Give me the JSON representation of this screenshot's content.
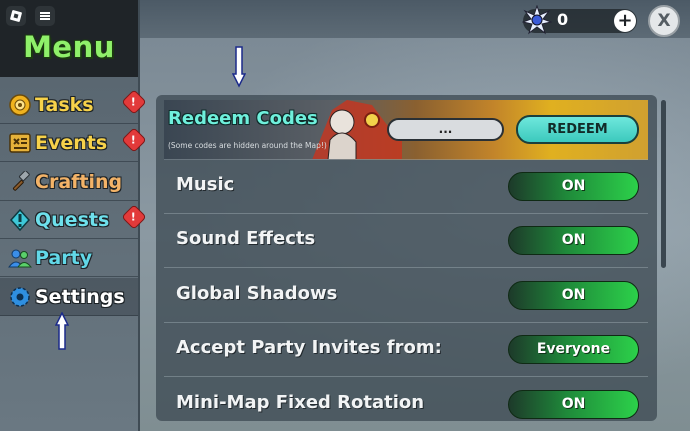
{
  "sidebar": {
    "title": "Menu",
    "items": [
      {
        "label": "Tasks",
        "color": "#f7d24a",
        "icon": "tasks-coin-icon",
        "alert": true
      },
      {
        "label": "Events",
        "color": "#f7d24a",
        "icon": "events-scroll-icon",
        "alert": true
      },
      {
        "label": "Crafting",
        "color": "#f3b368",
        "icon": "hammer-icon",
        "alert": false
      },
      {
        "label": "Quests",
        "color": "#6ee0ec",
        "icon": "quest-marker-icon",
        "alert": true
      },
      {
        "label": "Party",
        "color": "#62d8e8",
        "icon": "party-people-icon",
        "alert": false
      },
      {
        "label": "Settings",
        "color": "#ffffff",
        "icon": "gear-icon",
        "alert": false
      }
    ],
    "alert_glyph": "!"
  },
  "topbar": {
    "currency_icon": "spiky-orb-icon",
    "currency_value": "0",
    "plus_label": "+",
    "close_label": "X"
  },
  "settings": {
    "redeem": {
      "title": "Redeem Codes",
      "hint": "(Some codes are hidden around the Map!)",
      "input_value": "...",
      "button_label": "REDEEM"
    },
    "rows": [
      {
        "label": "Music",
        "value": "ON"
      },
      {
        "label": "Sound Effects",
        "value": "ON"
      },
      {
        "label": "Global Shadows",
        "value": "ON"
      },
      {
        "label": "Accept Party Invites from:",
        "value": "Everyone"
      },
      {
        "label": "Mini-Map Fixed Rotation",
        "value": "ON"
      }
    ]
  },
  "colors": {
    "menu_title": "#8ff06a",
    "toggle_on": "#2cd14a",
    "redeem_accent": "#6ee7dc",
    "alert": "#e23a3a"
  }
}
